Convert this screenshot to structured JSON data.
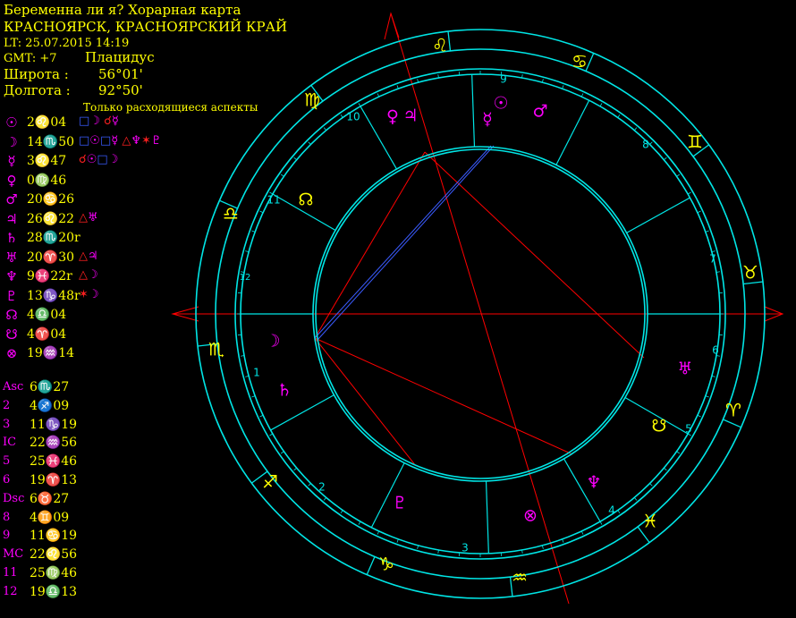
{
  "header": {
    "title": "Беременна ли я? Хорарная карта",
    "place": "КРАСНОЯРСК, КРАСНОЯРСКИЙ КРАЙ",
    "lt": "LT: 25.07.2015  14:19",
    "gmt": "GMT: +7",
    "system": "Плацидус",
    "lat_label": "Широта :",
    "lat_value": "56°01'",
    "lon_label": "Долгота :",
    "lon_value": "92°50'",
    "aspect_note": "Только расходящиеся аспекты"
  },
  "planets": [
    {
      "glyph": "☉",
      "pos": "2♌04",
      "aspects": "□☽ ☌☿"
    },
    {
      "glyph": "☽",
      "pos": "14♏50",
      "aspects": "□☉□☿ △♆✶♇"
    },
    {
      "glyph": "☿",
      "pos": "3♌47",
      "aspects": "☌☉□☽"
    },
    {
      "glyph": "♀",
      "pos": "0♍46",
      "aspects": ""
    },
    {
      "glyph": "♂",
      "pos": "20♋26",
      "aspects": ""
    },
    {
      "glyph": "♃",
      "pos": "26♌22",
      "aspects": "△♅"
    },
    {
      "glyph": "♄",
      "pos": "28♏20r",
      "aspects": ""
    },
    {
      "glyph": "♅",
      "pos": "20♈30",
      "aspects": "△♃"
    },
    {
      "glyph": "♆",
      "pos": "9♓22r",
      "aspects": "△☽"
    },
    {
      "glyph": "♇",
      "pos": "13♑48r",
      "aspects": "✶☽"
    },
    {
      "glyph": "☊",
      "pos": "4♎04",
      "aspects": ""
    },
    {
      "glyph": "☋",
      "pos": "4♈04",
      "aspects": ""
    },
    {
      "glyph": "⊗",
      "pos": "19♒14",
      "aspects": ""
    }
  ],
  "houses": [
    {
      "label": "Asc",
      "pos": "6♏27"
    },
    {
      "label": "2",
      "pos": "4♐09"
    },
    {
      "label": "3",
      "pos": "11♑19"
    },
    {
      "label": "IC",
      "pos": "22♒56"
    },
    {
      "label": "5",
      "pos": "25♓46"
    },
    {
      "label": "6",
      "pos": "19♈13"
    },
    {
      "label": "Dsc",
      "pos": "6♉27"
    },
    {
      "label": "8",
      "pos": "4♊09"
    },
    {
      "label": "9",
      "pos": "11♋19"
    },
    {
      "label": "MC",
      "pos": "22♌56"
    },
    {
      "label": "11",
      "pos": "25♍46"
    },
    {
      "label": "12",
      "pos": "19♎13"
    }
  ],
  "wheel": {
    "house_numbers": [
      "1",
      "2",
      "3",
      "4",
      "5",
      "6",
      "7",
      "8",
      "9",
      "10",
      "11",
      "12"
    ],
    "signs": [
      "♏",
      "♐",
      "♑",
      "♒",
      "♓",
      "♈",
      "♉",
      "♊",
      "♋",
      "♌",
      "♍",
      "♎"
    ],
    "planet_glyphs": {
      "moon": "☽",
      "saturn": "♄",
      "pluto": "♇",
      "fortune": "⊗",
      "neptune": "♆",
      "node_s": "☋",
      "uranus": "♅",
      "node_n": "☊",
      "venus": "♀",
      "jupiter": "♃",
      "mercury": "☿",
      "sun": "☉",
      "mars": "♂"
    }
  },
  "colors": {
    "ring": "#00e5e5",
    "sign": "#ffff00",
    "planet": "#ff00ff",
    "house_num": "#00e5e5",
    "axis": "#ff0000",
    "trine": "#3a5bff"
  }
}
